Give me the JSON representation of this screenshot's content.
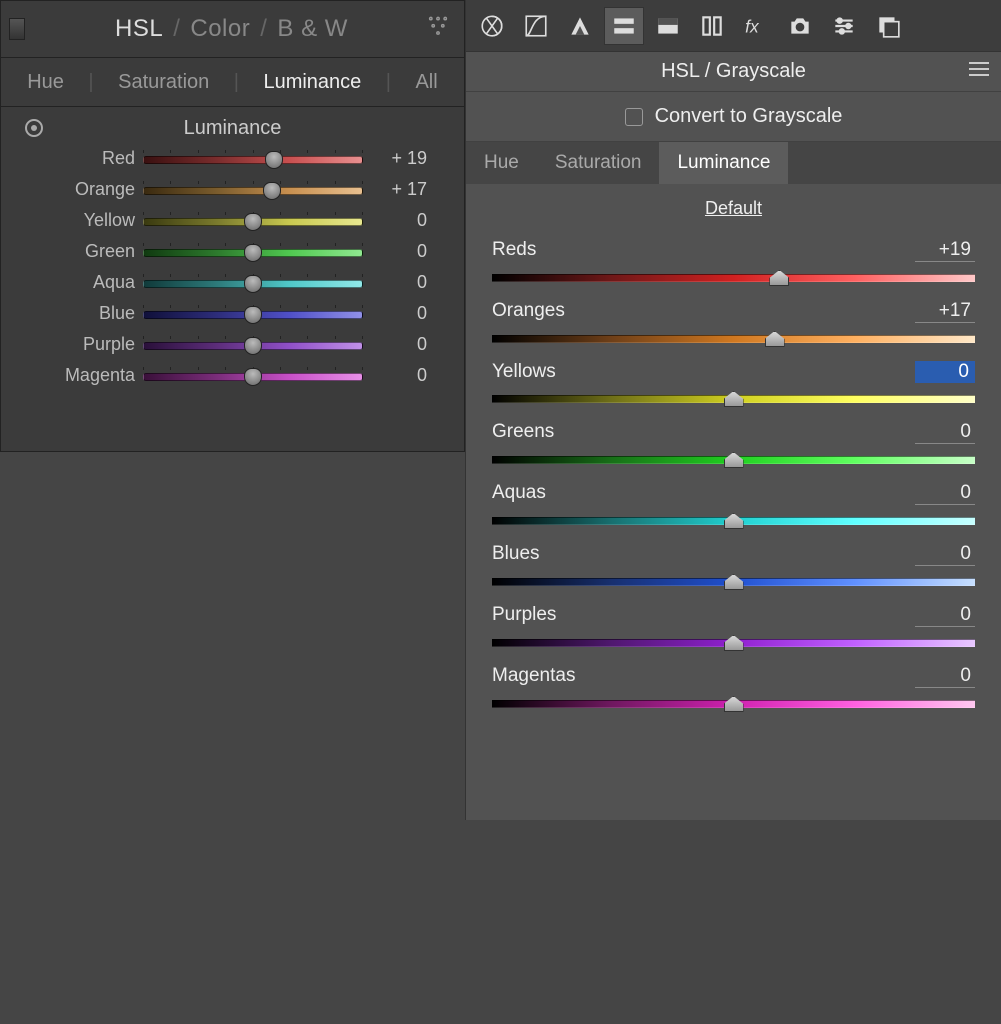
{
  "lr": {
    "modes": {
      "hsl": "HSL",
      "color": "Color",
      "bw": "B & W",
      "active": "HSL"
    },
    "tabs": {
      "hue": "Hue",
      "saturation": "Saturation",
      "luminance": "Luminance",
      "all": "All",
      "active": "Luminance"
    },
    "section_title": "Luminance",
    "rows": [
      {
        "label": "Red",
        "value": "+ 19",
        "pos": 59.5,
        "grad": "linear-gradient(90deg,#3a1010,#7a2d2d,#c85050,#e89090)"
      },
      {
        "label": "Orange",
        "value": "+ 17",
        "pos": 58.5,
        "grad": "linear-gradient(90deg,#3a2a10,#7a5c2d,#c89050,#e8c090)"
      },
      {
        "label": "Yellow",
        "value": "0",
        "pos": 50,
        "grad": "linear-gradient(90deg,#3a3a10,#7a7a2d,#c8c850,#e8e890)"
      },
      {
        "label": "Green",
        "value": "0",
        "pos": 50,
        "grad": "linear-gradient(90deg,#103a10,#2d7a2d,#50c850,#90e890)"
      },
      {
        "label": "Aqua",
        "value": "0",
        "pos": 50,
        "grad": "linear-gradient(90deg,#103a3a,#2d7a7a,#50c8c8,#90e8e8)"
      },
      {
        "label": "Blue",
        "value": "0",
        "pos": 50,
        "grad": "linear-gradient(90deg,#10103a,#2d2d7a,#5050c8,#9090e8)"
      },
      {
        "label": "Purple",
        "value": "0",
        "pos": 50,
        "grad": "linear-gradient(90deg,#2a103a,#5c2d7a,#9050c8,#c090e8)"
      },
      {
        "label": "Magenta",
        "value": "0",
        "pos": 50,
        "grad": "linear-gradient(90deg,#3a103a,#7a2d7a,#c850c8,#e890e8)"
      }
    ]
  },
  "cr": {
    "toolbar": [
      {
        "name": "basic-icon"
      },
      {
        "name": "curve-icon"
      },
      {
        "name": "detail-icon"
      },
      {
        "name": "hsl-icon",
        "active": true
      },
      {
        "name": "split-icon"
      },
      {
        "name": "lens-icon"
      },
      {
        "name": "fx-icon"
      },
      {
        "name": "camera-icon"
      },
      {
        "name": "presets-icon"
      },
      {
        "name": "snapshots-icon"
      }
    ],
    "title": "HSL / Grayscale",
    "convert_label": "Convert to Grayscale",
    "tabs": {
      "hue": "Hue",
      "saturation": "Saturation",
      "luminance": "Luminance",
      "active": "Luminance"
    },
    "default_label": "Default",
    "rows": [
      {
        "label": "Reds",
        "value": "+19",
        "pos": 59.5,
        "grad": "linear-gradient(90deg,#000,#701818,#d02020,#ff6060,#ffc8c8)"
      },
      {
        "label": "Oranges",
        "value": "+17",
        "pos": 58.5,
        "grad": "linear-gradient(90deg,#000,#704018,#d07820,#ffb060,#ffe8c8)"
      },
      {
        "label": "Yellows",
        "value": "0",
        "pos": 50,
        "sel": true,
        "grad": "linear-gradient(90deg,#000,#707018,#d0d020,#ffff60,#ffffc8)"
      },
      {
        "label": "Greens",
        "value": "0",
        "pos": 50,
        "grad": "linear-gradient(90deg,#000,#187018,#20d020,#60ff60,#c8ffc8)"
      },
      {
        "label": "Aquas",
        "value": "0",
        "pos": 50,
        "grad": "linear-gradient(90deg,#000,#187070,#20d0d0,#60ffff,#c8ffff)"
      },
      {
        "label": "Blues",
        "value": "0",
        "pos": 50,
        "grad": "linear-gradient(90deg,#000,#183070,#2050d0,#6090ff,#c8e0ff)"
      },
      {
        "label": "Purples",
        "value": "0",
        "pos": 50,
        "grad": "linear-gradient(90deg,#000,#501870,#9020d0,#c060ff,#e8c8ff)"
      },
      {
        "label": "Magentas",
        "value": "0",
        "pos": 50,
        "grad": "linear-gradient(90deg,#000,#701860,#d020b0,#ff60e0,#ffc8f0)"
      }
    ]
  }
}
